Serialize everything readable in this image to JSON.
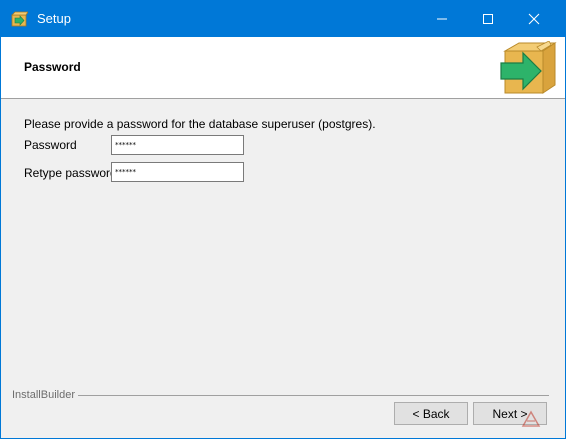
{
  "window": {
    "title": "Setup",
    "app_icon": "installer-box-icon",
    "controls": [
      "minimize-icon",
      "maximize-icon",
      "close-icon"
    ]
  },
  "header": {
    "title": "Password",
    "graphic": "box-arrow-icon"
  },
  "form": {
    "prompt": "Please provide a password for the database superuser (postgres).",
    "password_label": "Password",
    "password_value": "******",
    "retype_label": "Retype password",
    "retype_value": "******"
  },
  "footer": {
    "brand": "InstallBuilder",
    "back_label": "< Back",
    "next_label": "Next >"
  },
  "colors": {
    "titlebar": "#0078d7",
    "dialog_bg": "#f0f0f0",
    "header_bg": "#ffffff",
    "box_tan": "#e8b64f",
    "arrow_green": "#2db36a"
  }
}
